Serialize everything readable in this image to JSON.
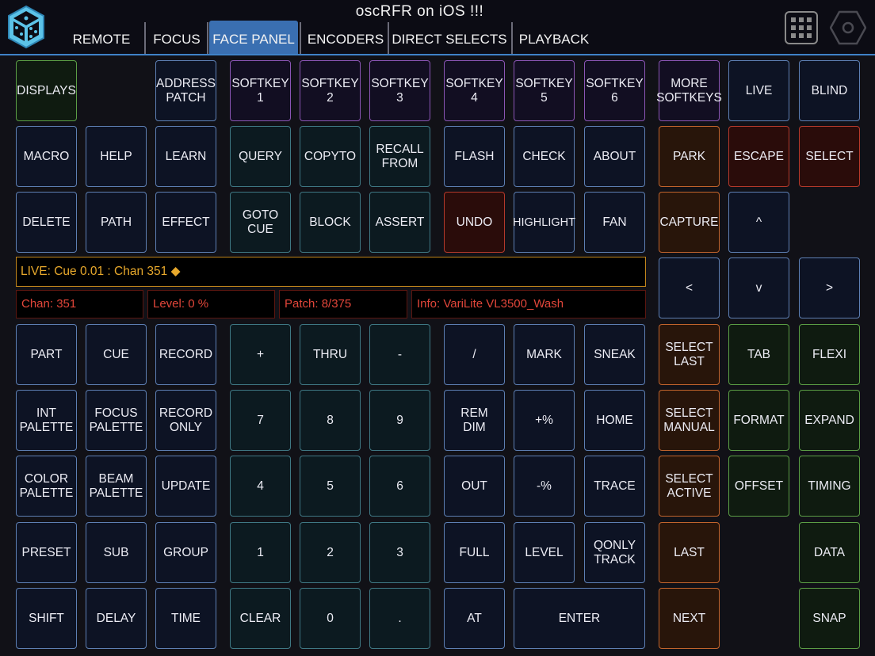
{
  "app_title": "oscRFR  on  iOS !!!",
  "tabs": [
    {
      "label": "REMOTE",
      "active": false
    },
    {
      "label": "FOCUS",
      "active": false
    },
    {
      "label": "FACE PANEL",
      "active": true
    },
    {
      "label": "ENCODERS",
      "active": false
    },
    {
      "label": "DIRECT SELECTS",
      "active": false
    },
    {
      "label": "PLAYBACK",
      "active": false
    }
  ],
  "icons": {
    "logo": "cube-logo-icon",
    "grid": "grid-menu-icon",
    "settings": "hexagon-settings-icon"
  },
  "colors": {
    "tab_active": "#3a6fb1",
    "command_line_border": "#c0851b",
    "command_line_text": "#e8a92c",
    "info_text": "#e2463a"
  },
  "command_line": "LIVE: Cue  0.01 : Chan 351 ◆",
  "info_fields": {
    "channel": "Chan: 351",
    "level": "Level: 0 %",
    "patch": "Patch: 8/375",
    "info": "Info:  VariLite VL3500_Wash"
  },
  "buttons": [
    {
      "label": "DISPLAYS",
      "color": "green"
    },
    {
      "label": "ADDRESS\nPATCH",
      "color": "blue"
    },
    {
      "label": "SOFTKEY\n1",
      "color": "purple"
    },
    {
      "label": "SOFTKEY\n2",
      "color": "purple"
    },
    {
      "label": "SOFTKEY\n3",
      "color": "purple"
    },
    {
      "label": "SOFTKEY\n4",
      "color": "purple"
    },
    {
      "label": "SOFTKEY\n5",
      "color": "purple"
    },
    {
      "label": "SOFTKEY\n6",
      "color": "purple"
    },
    {
      "label": "MORE\nSOFTKEYS",
      "color": "purple"
    },
    {
      "label": "LIVE",
      "color": "blue"
    },
    {
      "label": "BLIND",
      "color": "blue"
    },
    {
      "label": "MACRO",
      "color": "blue"
    },
    {
      "label": "HELP",
      "color": "blue"
    },
    {
      "label": "LEARN",
      "color": "blue"
    },
    {
      "label": "QUERY",
      "color": "teal"
    },
    {
      "label": "COPYTO",
      "color": "teal"
    },
    {
      "label": "RECALL\nFROM",
      "color": "teal"
    },
    {
      "label": "FLASH",
      "color": "blue"
    },
    {
      "label": "CHECK",
      "color": "blue"
    },
    {
      "label": "ABOUT",
      "color": "blue"
    },
    {
      "label": "PARK",
      "color": "orange"
    },
    {
      "label": "ESCAPE",
      "color": "red"
    },
    {
      "label": "SELECT",
      "color": "red"
    },
    {
      "label": "DELETE",
      "color": "blue"
    },
    {
      "label": "PATH",
      "color": "blue"
    },
    {
      "label": "EFFECT",
      "color": "blue"
    },
    {
      "label": "GOTO\nCUE",
      "color": "teal"
    },
    {
      "label": "BLOCK",
      "color": "teal"
    },
    {
      "label": "ASSERT",
      "color": "teal"
    },
    {
      "label": "UNDO",
      "color": "red"
    },
    {
      "label": "HIGHLIGHT",
      "color": "blue"
    },
    {
      "label": "FAN",
      "color": "blue"
    },
    {
      "label": "CAPTURE",
      "color": "orange"
    },
    {
      "label": "^",
      "color": "blue"
    },
    {
      "label": "<",
      "color": "blue"
    },
    {
      "label": "v",
      "color": "blue"
    },
    {
      "label": ">",
      "color": "blue"
    },
    {
      "label": "PART",
      "color": "blue"
    },
    {
      "label": "CUE",
      "color": "blue"
    },
    {
      "label": "RECORD",
      "color": "blue"
    },
    {
      "label": "+",
      "color": "teal"
    },
    {
      "label": "THRU",
      "color": "teal"
    },
    {
      "label": "-",
      "color": "teal"
    },
    {
      "label": "/",
      "color": "blue"
    },
    {
      "label": "MARK",
      "color": "blue"
    },
    {
      "label": "SNEAK",
      "color": "blue"
    },
    {
      "label": "SELECT\nLAST",
      "color": "orange"
    },
    {
      "label": "TAB",
      "color": "green"
    },
    {
      "label": "FLEXI",
      "color": "green"
    },
    {
      "label": "INT\nPALETTE",
      "color": "blue"
    },
    {
      "label": "FOCUS\nPALETTE",
      "color": "blue"
    },
    {
      "label": "RECORD\nONLY",
      "color": "blue"
    },
    {
      "label": "7",
      "color": "teal"
    },
    {
      "label": "8",
      "color": "teal"
    },
    {
      "label": "9",
      "color": "teal"
    },
    {
      "label": "REM\nDIM",
      "color": "blue"
    },
    {
      "label": "+%",
      "color": "blue"
    },
    {
      "label": "HOME",
      "color": "blue"
    },
    {
      "label": "SELECT\nMANUAL",
      "color": "orange"
    },
    {
      "label": "FORMAT",
      "color": "green"
    },
    {
      "label": "EXPAND",
      "color": "green"
    },
    {
      "label": "COLOR\nPALETTE",
      "color": "blue"
    },
    {
      "label": "BEAM\nPALETTE",
      "color": "blue"
    },
    {
      "label": "UPDATE",
      "color": "blue"
    },
    {
      "label": "4",
      "color": "teal"
    },
    {
      "label": "5",
      "color": "teal"
    },
    {
      "label": "6",
      "color": "teal"
    },
    {
      "label": "OUT",
      "color": "blue"
    },
    {
      "label": "-%",
      "color": "blue"
    },
    {
      "label": "TRACE",
      "color": "blue"
    },
    {
      "label": "SELECT\nACTIVE",
      "color": "orange"
    },
    {
      "label": "OFFSET",
      "color": "green"
    },
    {
      "label": "TIMING",
      "color": "green"
    },
    {
      "label": "PRESET",
      "color": "blue"
    },
    {
      "label": "SUB",
      "color": "blue"
    },
    {
      "label": "GROUP",
      "color": "blue"
    },
    {
      "label": "1",
      "color": "teal"
    },
    {
      "label": "2",
      "color": "teal"
    },
    {
      "label": "3",
      "color": "teal"
    },
    {
      "label": "FULL",
      "color": "blue"
    },
    {
      "label": "LEVEL",
      "color": "blue"
    },
    {
      "label": "QONLY\nTRACK",
      "color": "blue"
    },
    {
      "label": "LAST",
      "color": "orange"
    },
    {
      "label": "DATA",
      "color": "green"
    },
    {
      "label": "SHIFT",
      "color": "blue"
    },
    {
      "label": "DELAY",
      "color": "blue"
    },
    {
      "label": "TIME",
      "color": "blue"
    },
    {
      "label": "CLEAR",
      "color": "teal"
    },
    {
      "label": "0",
      "color": "teal"
    },
    {
      "label": ".",
      "color": "teal"
    },
    {
      "label": "AT",
      "color": "blue"
    },
    {
      "label": "ENTER",
      "color": "blue"
    },
    {
      "label": "NEXT",
      "color": "orange"
    },
    {
      "label": "SNAP",
      "color": "green"
    }
  ]
}
